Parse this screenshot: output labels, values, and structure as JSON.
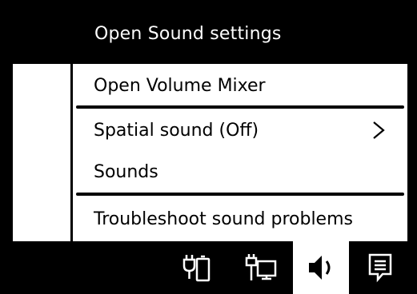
{
  "header": {
    "open_sound_settings": "Open Sound settings"
  },
  "menu": {
    "items": [
      {
        "label": "Open Volume Mixer"
      },
      {
        "label": "Spatial sound (Off)",
        "has_submenu": true,
        "icon": "chevron-right-icon"
      },
      {
        "label": "Sounds"
      },
      {
        "label": "Troubleshoot sound problems"
      }
    ]
  },
  "taskbar": {
    "icons": [
      {
        "name": "power-battery-icon"
      },
      {
        "name": "network-icon"
      },
      {
        "name": "speaker-icon",
        "active": true
      },
      {
        "name": "action-center-icon"
      }
    ]
  },
  "colors": {
    "background": "#000000",
    "foreground": "#ffffff",
    "menu_bg": "#ffffff",
    "menu_text": "#000000"
  }
}
